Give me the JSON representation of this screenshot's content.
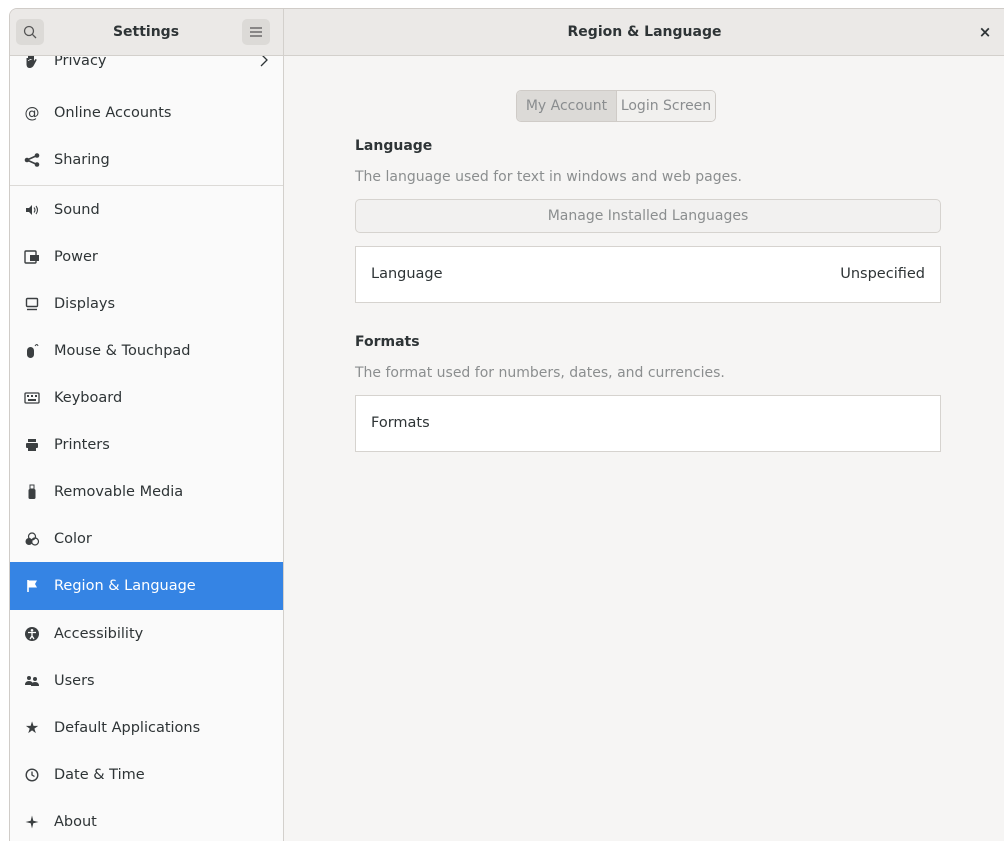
{
  "header": {
    "sidebar_title": "Settings",
    "page_title": "Region & Language",
    "close_label": "×"
  },
  "sidebar": {
    "items": [
      {
        "label": "Privacy",
        "icon": "hand-icon"
      },
      {
        "label": "Online Accounts",
        "icon": "at-icon"
      },
      {
        "label": "Sharing",
        "icon": "share-icon"
      },
      {
        "label": "Sound",
        "icon": "speaker-icon"
      },
      {
        "label": "Power",
        "icon": "battery-icon"
      },
      {
        "label": "Displays",
        "icon": "monitor-icon"
      },
      {
        "label": "Mouse & Touchpad",
        "icon": "mouse-icon"
      },
      {
        "label": "Keyboard",
        "icon": "keyboard-icon"
      },
      {
        "label": "Printers",
        "icon": "printer-icon"
      },
      {
        "label": "Removable Media",
        "icon": "usb-icon"
      },
      {
        "label": "Color",
        "icon": "color-icon"
      },
      {
        "label": "Region & Language",
        "icon": "flag-icon",
        "active": true
      },
      {
        "label": "Accessibility",
        "icon": "accessibility-icon"
      },
      {
        "label": "Users",
        "icon": "users-icon"
      },
      {
        "label": "Default Applications",
        "icon": "star-icon"
      },
      {
        "label": "Date & Time",
        "icon": "clock-icon"
      },
      {
        "label": "About",
        "icon": "sparkle-icon"
      }
    ]
  },
  "main": {
    "tabs": [
      {
        "label": "My Account",
        "selected": true
      },
      {
        "label": "Login Screen",
        "selected": false
      }
    ],
    "language": {
      "title": "Language",
      "description": "The language used for text in windows and web pages.",
      "manage_button": "Manage Installed Languages",
      "row_label": "Language",
      "row_value": "Unspecified"
    },
    "formats": {
      "title": "Formats",
      "description": "The format used for numbers, dates, and currencies.",
      "row_label": "Formats"
    }
  },
  "colors": {
    "accent": "#3584e4",
    "sidebar_bg": "#fafafa",
    "content_bg": "#f6f5f4"
  }
}
